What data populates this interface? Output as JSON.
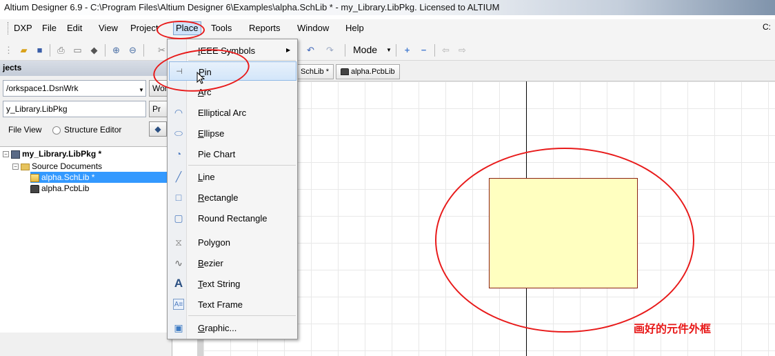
{
  "window": {
    "title": "Altium Designer 6.9 - C:\\Program Files\\Altium Designer 6\\Examples\\alpha.SchLib * - my_Library.LibPkg. Licensed to ALTIUM"
  },
  "menubar": {
    "items": [
      "DXP",
      "File",
      "Edit",
      "View",
      "Project",
      "Place",
      "Tools",
      "Reports",
      "Window",
      "Help"
    ],
    "right_text": "C:"
  },
  "toolbar": {
    "mode_label": "Mode"
  },
  "projects_panel": {
    "header": "jects",
    "workspace_value": "/orkspace1.DsnWrk",
    "workspace_button": "Wor",
    "project_value": "y_Library.LibPkg",
    "project_button": "Pr",
    "view_options": [
      "File View",
      "Structure Editor"
    ],
    "tree": {
      "project": "my_Library.LibPkg *",
      "folder": "Source Documents",
      "documents": [
        "alpha.SchLib *",
        "alpha.PcbLib"
      ]
    }
  },
  "document_tabs": [
    "SchLib *",
    "alpha.PcbLib"
  ],
  "place_menu": {
    "items": [
      {
        "label": "IEEE Symbols",
        "icon": "submenu",
        "has_submenu": true
      },
      {
        "label": "Pin",
        "icon": "pin-icon",
        "highlighted": true
      },
      {
        "label": "Arc",
        "icon": "arc-icon"
      },
      {
        "label": "Elliptical Arc",
        "icon": "elliptical-arc-icon"
      },
      {
        "label": "Ellipse",
        "icon": "ellipse-icon"
      },
      {
        "label": "Pie Chart",
        "icon": "pie-chart-icon"
      },
      {
        "label": "Line",
        "icon": "line-icon"
      },
      {
        "label": "Rectangle",
        "icon": "rectangle-icon"
      },
      {
        "label": "Round Rectangle",
        "icon": "round-rectangle-icon"
      },
      {
        "label": "Polygon",
        "icon": "polygon-icon"
      },
      {
        "label": "Bezier",
        "icon": "bezier-icon"
      },
      {
        "label": "Text String",
        "icon": "text-string-icon"
      },
      {
        "label": "Text Frame",
        "icon": "text-frame-icon"
      },
      {
        "label": "Graphic...",
        "icon": "graphic-icon"
      }
    ]
  },
  "canvas": {
    "annotation": "画好的元件外框",
    "component_fill": "#ffffc0",
    "component_border": "#8a1f11"
  },
  "colors": {
    "annotation_red": "#e81a1a",
    "selection_blue": "#3399ff"
  }
}
